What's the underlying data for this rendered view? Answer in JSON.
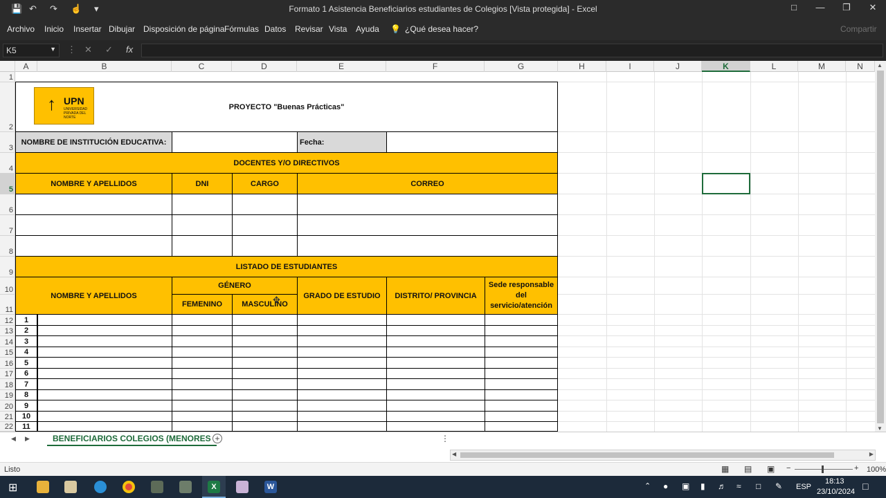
{
  "window": {
    "title": "Formato 1 Asistencia Beneficiarios estudiantes de Colegios  [Vista protegida]  -  Excel",
    "share_label": "Compartir"
  },
  "ribbon": {
    "tabs": [
      "Archivo",
      "Inicio",
      "Insertar",
      "Dibujar",
      "Disposición de página",
      "Fórmulas",
      "Datos",
      "Revisar",
      "Vista",
      "Ayuda"
    ],
    "tell_me": "¿Qué desea hacer?"
  },
  "formula_bar": {
    "name_box": "K5",
    "fx_label": "fx",
    "formula": ""
  },
  "columns": [
    "A",
    "B",
    "C",
    "D",
    "E",
    "F",
    "G",
    "H",
    "I",
    "J",
    "K",
    "L",
    "M",
    "N"
  ],
  "rows": [
    "1",
    "2",
    "3",
    "4",
    "5",
    "6",
    "7",
    "8",
    "9",
    "10",
    "11",
    "12",
    "13",
    "14",
    "15",
    "16",
    "17",
    "18",
    "19",
    "20",
    "21",
    "22"
  ],
  "selected_cell": "K5",
  "sheet": {
    "logo_text": "UPN",
    "logo_subtext": "UNIVERSIDAD PRIVADA DEL NORTE",
    "project_title": "PROYECTO \"Buenas Prácticas\"",
    "institution_label": "NOMBRE DE INSTITUCIÓN EDUCATIVA:",
    "date_label": "Fecha:",
    "teachers_section": "DOCENTES Y/O DIRECTIVOS",
    "teacher_headers": {
      "name": "NOMBRE Y APELLIDOS",
      "dni": "DNI",
      "role": "CARGO",
      "email": "CORREO"
    },
    "students_section": "LISTADO DE ESTUDIANTES",
    "student_headers": {
      "name": "NOMBRE Y APELLIDOS",
      "gender": "GÉNERO",
      "female": "FEMENINO",
      "male": "MASCULINO",
      "grade": "GRADO DE ESTUDIO",
      "district": "DISTRITO/ PROVINCIA",
      "venue": "Sede responsable del servicio/atención"
    },
    "student_numbers": [
      "1",
      "2",
      "3",
      "4",
      "5",
      "6",
      "7",
      "8",
      "9",
      "10",
      "11"
    ]
  },
  "sheet_tab": "BENEFICIARIOS COLEGIOS (MENORES",
  "status": {
    "ready": "Listo",
    "zoom": "100%"
  },
  "taskbar": {
    "language": "ESP",
    "time": "18:13",
    "date": "23/10/2024"
  },
  "colors": {
    "accent": "#ffc000",
    "excel_green": "#1e6b3a"
  }
}
